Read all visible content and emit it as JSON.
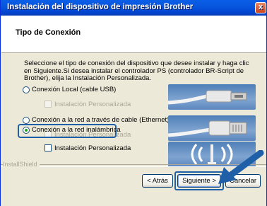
{
  "window": {
    "title": "Instalación del dispositivo de impresión Brother",
    "close_glyph": "x"
  },
  "header": {
    "title": "Tipo de Conexión"
  },
  "description": "Seleccione el tipo de conexión del dispositivo que desee instalar y haga clic en Siguiente.Si desea instalar el controlador PS (controlador BR-Script de Brother), elija la Instalación Personalizada.",
  "options": [
    {
      "label": "Conexión Local (cable USB)",
      "selected": false,
      "custom_label": "Instalación Personalizada",
      "custom_enabled": false,
      "icon": "usb-cable-icon"
    },
    {
      "label": "Conexión a la red a través de cable (Ethernet)",
      "selected": false,
      "custom_label": "Instalación Personalizada",
      "custom_enabled": false,
      "icon": "ethernet-cable-icon"
    },
    {
      "label": "Conexión a la red inalámbrica",
      "selected": true,
      "custom_label": "Instalación Personalizada",
      "custom_enabled": true,
      "icon": "wireless-icon"
    }
  ],
  "footer": {
    "brand": "InstallShield",
    "back_label": "< Atrás",
    "next_label": "Siguiente >",
    "cancel_label": "Cancelar"
  },
  "colors": {
    "title_bar": "#0a5fe6",
    "highlight": "#1e5fa8",
    "selected_radio": "#21a121",
    "image_background": "#4f7fb8"
  }
}
